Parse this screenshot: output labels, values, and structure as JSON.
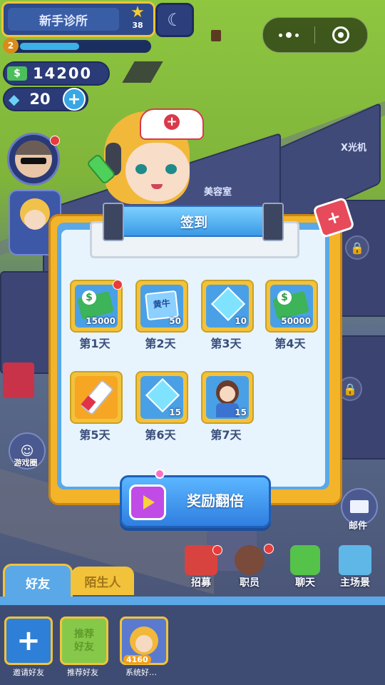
{
  "hud": {
    "clinic_name": "新手诊所",
    "star_count": "38",
    "level": "2",
    "level_progress": 0.45,
    "cash": "14200",
    "gems": "20",
    "add_label": "+"
  },
  "scene": {
    "xray_label": "X光机",
    "beauty_label": "美容室",
    "game_circle_label": "游戏圈",
    "mail_label": "邮件"
  },
  "dialog": {
    "title": "签到",
    "days": [
      {
        "label": "第1天",
        "qty": "15000",
        "icon": "cash-bundle-icon",
        "badge": true
      },
      {
        "label": "第2天",
        "qty": "50",
        "icon": "booklet-icon",
        "item_text": "黄牛"
      },
      {
        "label": "第3天",
        "qty": "10",
        "icon": "diamond-icon"
      },
      {
        "label": "第4天",
        "qty": "50000",
        "icon": "cash-bundle-icon"
      },
      {
        "label": "第5天",
        "qty": "",
        "icon": "syringe-icon"
      },
      {
        "label": "第6天",
        "qty": "15",
        "icon": "diamond-icon"
      },
      {
        "label": "第7天",
        "qty": "15",
        "icon": "character-card-icon"
      }
    ],
    "double_button": "奖励翻倍"
  },
  "bottom": {
    "tabs": [
      "好友",
      "陌生人"
    ],
    "menu": [
      "招募",
      "职员",
      "聊天",
      "主场景"
    ],
    "friends": [
      {
        "label": "邀请好友",
        "icon": "plus-icon"
      },
      {
        "label": "推荐好友",
        "inner": "推荐\n好友"
      },
      {
        "label": "系统好…",
        "score": "4160"
      }
    ]
  },
  "colors": {
    "accent": "#f2c33a",
    "panel_blue": "#5aa8e8",
    "button_blue": "#3f8fe0"
  }
}
